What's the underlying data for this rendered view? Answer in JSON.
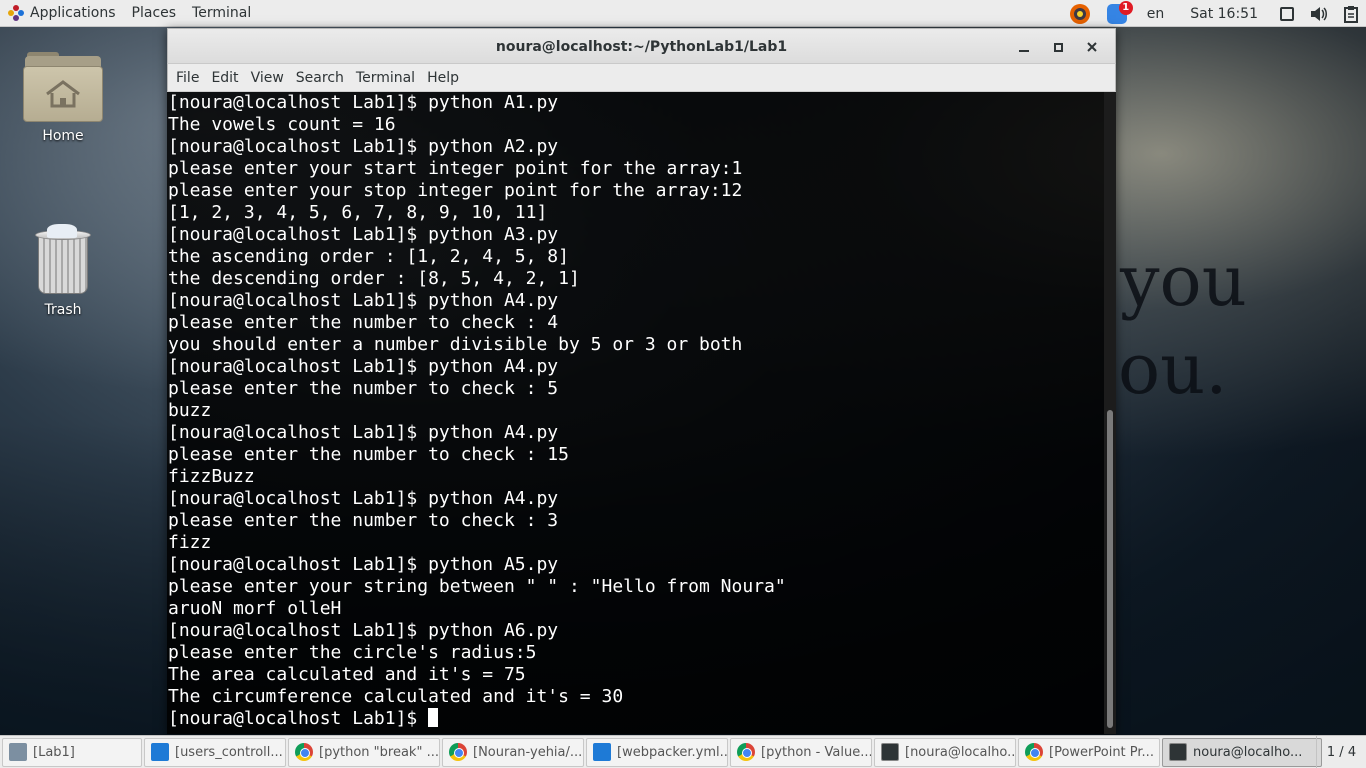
{
  "topbar": {
    "applications": "Applications",
    "places": "Places",
    "terminal": "Terminal",
    "notification_count": "1",
    "language": "en",
    "clock": "Sat 16:51"
  },
  "desktop": {
    "home_label": "Home",
    "trash_label": "Trash"
  },
  "window": {
    "title": "noura@localhost:~/PythonLab1/Lab1",
    "menu": [
      "File",
      "Edit",
      "View",
      "Search",
      "Terminal",
      "Help"
    ]
  },
  "terminal": {
    "lines": [
      "[noura@localhost Lab1]$ python A1.py",
      "The vowels count = 16",
      "[noura@localhost Lab1]$ python A2.py",
      "please enter your start integer point for the array:1",
      "please enter your stop integer point for the array:12",
      "[1, 2, 3, 4, 5, 6, 7, 8, 9, 10, 11]",
      "[noura@localhost Lab1]$ python A3.py",
      "the ascending order : [1, 2, 4, 5, 8]",
      "the descending order : [8, 5, 4, 2, 1]",
      "[noura@localhost Lab1]$ python A4.py",
      "please enter the number to check : 4",
      "you should enter a number divisible by 5 or 3 or both",
      "[noura@localhost Lab1]$ python A4.py",
      "please enter the number to check : 5",
      "buzz",
      "[noura@localhost Lab1]$ python A4.py",
      "please enter the number to check : 15",
      "fizzBuzz",
      "[noura@localhost Lab1]$ python A4.py",
      "please enter the number to check : 3",
      "fizz",
      "[noura@localhost Lab1]$ python A5.py",
      "please enter your string between \" \" : \"Hello from Noura\"",
      "aruoN morf olleH",
      "[noura@localhost Lab1]$ python A6.py",
      "please enter the circle's radius:5",
      "The area calculated and it's = 75",
      "The circumference calculated and it's = 30"
    ],
    "prompt": "[noura@localhost Lab1]$ "
  },
  "wallpaper": {
    "line1": "you",
    "line2": "ou."
  },
  "taskbar": {
    "tasks": [
      {
        "label": "[Lab1]",
        "icon": "files-icon"
      },
      {
        "label": "[users_controll...",
        "icon": "vscode-icon"
      },
      {
        "label": "[python \"break\" ...",
        "icon": "chrome-icon"
      },
      {
        "label": "[Nouran-yehia/...",
        "icon": "chrome-icon"
      },
      {
        "label": "[webpacker.yml...",
        "icon": "vscode-icon"
      },
      {
        "label": "[python - Value...",
        "icon": "chrome-icon"
      },
      {
        "label": "[noura@localho...",
        "icon": "terminal-icon"
      },
      {
        "label": "[PowerPoint Pr...",
        "icon": "chrome-icon"
      },
      {
        "label": "noura@localho...",
        "icon": "terminal-icon"
      }
    ],
    "workspace": "1 / 4"
  }
}
